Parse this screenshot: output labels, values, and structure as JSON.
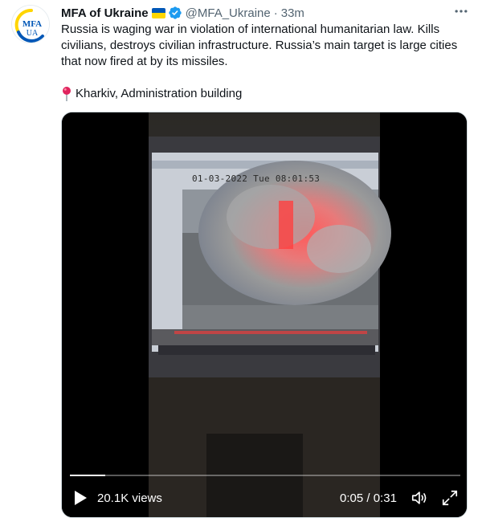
{
  "account": {
    "name": "MFA of Ukraine",
    "handle": "@MFA_Ukraine",
    "separator": "·",
    "timestamp": "33m",
    "avatar_text_top": "MFA",
    "avatar_text_bottom": "UA",
    "flag_colors": [
      "#0057b7",
      "#ffd700"
    ],
    "verified_color": "#1d9bf0"
  },
  "tweet": {
    "text": "Russia is waging war in violation of international humanitarian law. Kills civilians, destroys civilian infrastructure. Russia’s main target is large cities that now fired at by its missiles.",
    "location": "Kharkiv, Administration building",
    "location_icon": "round-pushpin-icon"
  },
  "video": {
    "cctv_timestamp": "01-03-2022 Tue 08:01:53",
    "views": "20.1K views",
    "elapsed": "0:05",
    "duration_separator": "/",
    "total": "0:31",
    "progress": 0.09
  },
  "icons": {
    "more": "more-dots-icon",
    "play": "play-icon",
    "volume": "volume-icon",
    "fullscreen": "fullscreen-icon"
  }
}
